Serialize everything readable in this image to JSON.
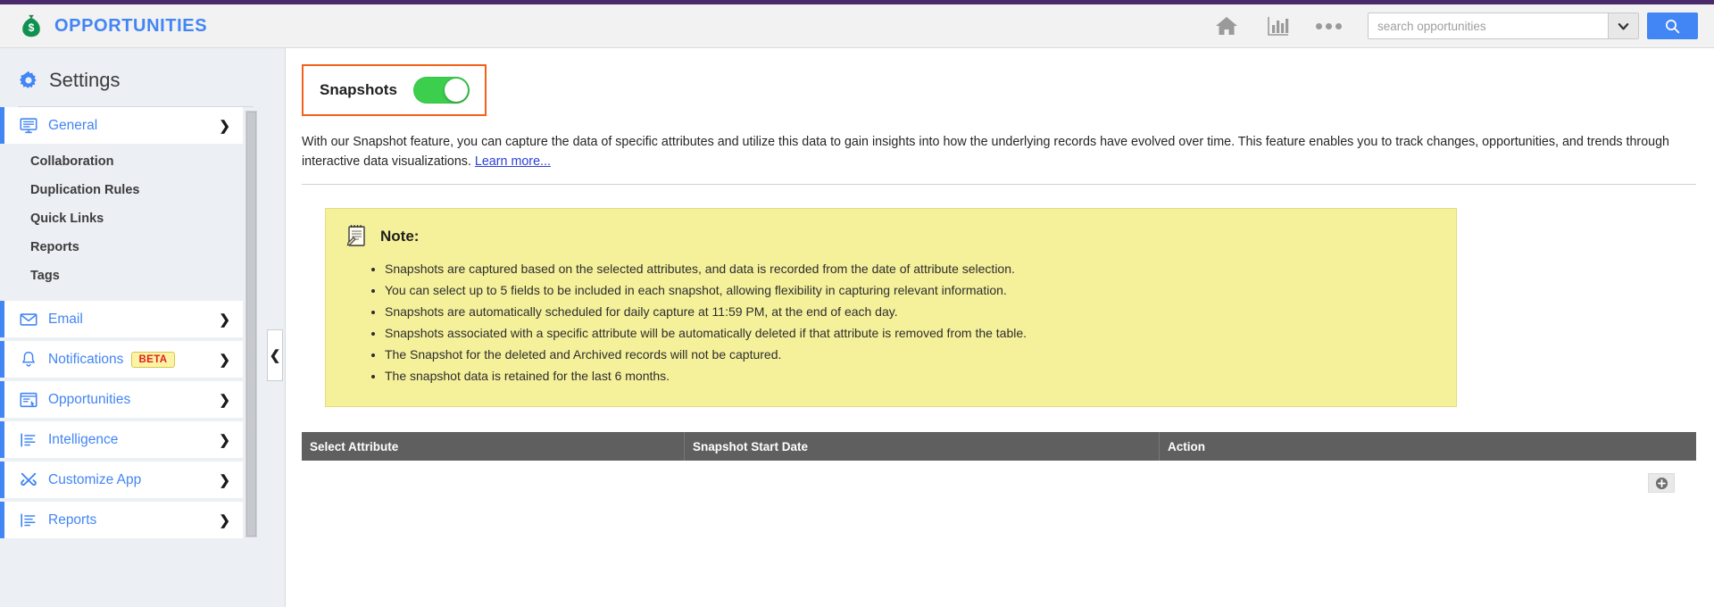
{
  "header": {
    "brand_title": "OPPORTUNITIES",
    "brand_icon": "money-bag-icon",
    "icons": [
      {
        "name": "home-icon",
        "label": "Home"
      },
      {
        "name": "bar-chart-icon",
        "label": "Analytics"
      },
      {
        "name": "more-options-icon",
        "label": "More"
      }
    ],
    "search": {
      "placeholder": "search opportunities",
      "value": "",
      "dropdown_icon": "chevron-down-icon",
      "button_icon": "search-icon",
      "accent_color": "#4285f4"
    },
    "top_strip_color": "#4b2a6b"
  },
  "sidebar": {
    "title": "Settings",
    "gear_icon": "gear-icon",
    "items": [
      {
        "label": "General",
        "icon": "monitor-icon",
        "type": "group",
        "active": true,
        "chevron": "❯"
      },
      {
        "label": "Collaboration",
        "type": "sub"
      },
      {
        "label": "Duplication Rules",
        "type": "sub"
      },
      {
        "label": "Quick Links",
        "type": "sub"
      },
      {
        "label": "Reports",
        "type": "sub"
      },
      {
        "label": "Tags",
        "type": "sub"
      },
      {
        "label": "Email",
        "icon": "envelope-icon",
        "type": "group",
        "chevron": "❯"
      },
      {
        "label": "Notifications",
        "icon": "bell-icon",
        "type": "group",
        "badge": "BETA",
        "chevron": "❯"
      },
      {
        "label": "Opportunities",
        "icon": "opportunity-icon",
        "type": "group",
        "chevron": "❯"
      },
      {
        "label": "Intelligence",
        "icon": "list-icon",
        "type": "group",
        "chevron": "❯"
      },
      {
        "label": "Customize App",
        "icon": "tools-icon",
        "type": "group",
        "chevron": "❯"
      },
      {
        "label": "Reports",
        "icon": "list-icon",
        "type": "group",
        "chevron": "❯"
      }
    ],
    "badge_color": "#e02020",
    "active_color": "#4285f4"
  },
  "collapse": {
    "icon": "chevron-left-icon",
    "glyph": "❮"
  },
  "main": {
    "snapshots": {
      "label": "Snapshots",
      "toggle_state": "on",
      "toggle_color": "#3ccf4e",
      "highlight_color": "#f4601a"
    },
    "description": {
      "text_before_link": "With our Snapshot feature, you can capture the data of specific attributes and utilize this data to gain insights into how the underlying records have evolved over time. This feature enables you to track changes, opportunities, and trends through interactive data visualizations. ",
      "link_text": "Learn more..."
    },
    "note": {
      "icon": "notepad-icon",
      "title": "Note:",
      "background_color": "#f5f09a",
      "bullets": [
        "Snapshots are captured based on the selected attributes, and data is recorded from the date of attribute selection.",
        "You can select up to 5 fields to be included in each snapshot, allowing flexibility in capturing relevant information.",
        "Snapshots are automatically scheduled for daily capture at 11:59 PM, at the end of each day.",
        "Snapshots associated with a specific attribute will be automatically deleted if that attribute is removed from the table.",
        "The Snapshot for the deleted and Archived records will not be captured.",
        "The snapshot data is retained for the last 6 months."
      ]
    },
    "table": {
      "columns": [
        "Select Attribute",
        "Snapshot Start Date",
        "Action"
      ],
      "rows": [],
      "header_background": "#5f5f5f",
      "add_button_icon": "plus-circle-icon"
    }
  }
}
